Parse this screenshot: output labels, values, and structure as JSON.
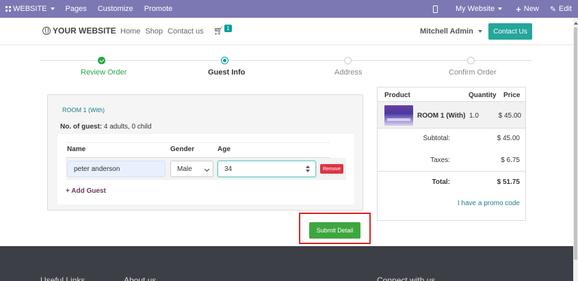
{
  "admin_bar": {
    "website_label": "WEBSITE",
    "pages_label": "Pages",
    "customize_label": "Customize",
    "promote_label": "Promote",
    "my_website_label": "My Website",
    "new_label": "New",
    "edit_label": "Edit"
  },
  "header": {
    "logo_text": "YOUR WEBSITE",
    "nav": [
      "Home",
      "Shop",
      "Contact us"
    ],
    "cart_count": "1",
    "user_name": "Mitchell Admin",
    "contact_button": "Contact Us"
  },
  "steps": [
    {
      "label": "Review Order",
      "state": "done"
    },
    {
      "label": "Guest Info",
      "state": "current"
    },
    {
      "label": "Address",
      "state": "todo"
    },
    {
      "label": "Confirm Order",
      "state": "todo"
    }
  ],
  "guest_form": {
    "room_title": "ROOM 1 (With)",
    "guests_label": "No. of guest:",
    "guests_value": "4 adults, 0 child",
    "columns": {
      "name": "Name",
      "gender": "Gender",
      "age": "Age"
    },
    "row": {
      "name": "peter anderson",
      "gender": "Male",
      "age": "34"
    },
    "remove_label": "Remove",
    "add_guest_label": "+ Add Guest"
  },
  "submit_label": "Submit Detail",
  "summary": {
    "headers": {
      "product": "Product",
      "quantity": "Quantity",
      "price": "Price"
    },
    "item": {
      "name": "ROOM 1 (With)",
      "qty": "1.0",
      "price": "$ 45.00"
    },
    "subtotal_label": "Subtotal:",
    "subtotal_value": "$ 45.00",
    "taxes_label": "Taxes:",
    "taxes_value": "$ 6.75",
    "total_label": "Total:",
    "total_value": "$ 51.75",
    "promo_label": "I have a promo code"
  },
  "footer": {
    "useful_links": "Useful Links",
    "about_us": "About us",
    "connect": "Connect with us"
  },
  "colors": {
    "admin_bar": "#7c78b3",
    "accent": "#26a69a",
    "success": "#28a745",
    "danger": "#dc3545",
    "highlight_outline": "#e02020"
  }
}
